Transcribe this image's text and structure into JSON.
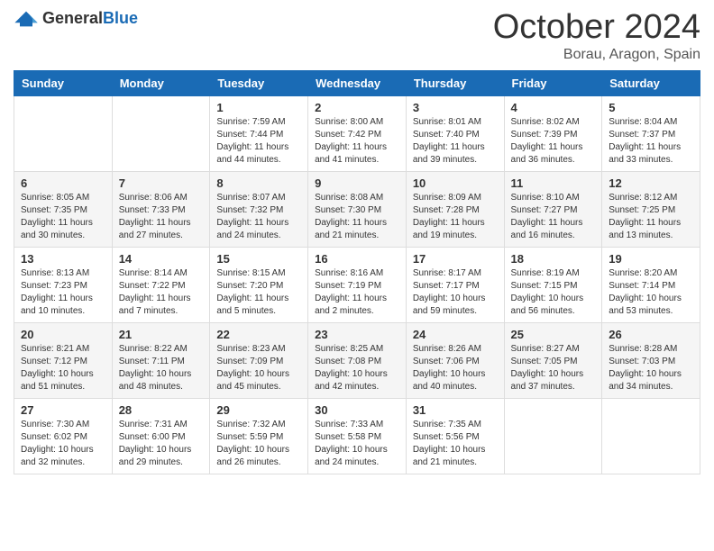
{
  "header": {
    "logo_general": "General",
    "logo_blue": "Blue",
    "month_title": "October 2024",
    "location": "Borau, Aragon, Spain"
  },
  "calendar": {
    "days_of_week": [
      "Sunday",
      "Monday",
      "Tuesday",
      "Wednesday",
      "Thursday",
      "Friday",
      "Saturday"
    ],
    "weeks": [
      [
        {
          "day": "",
          "info": ""
        },
        {
          "day": "",
          "info": ""
        },
        {
          "day": "1",
          "info": "Sunrise: 7:59 AM\nSunset: 7:44 PM\nDaylight: 11 hours and 44 minutes."
        },
        {
          "day": "2",
          "info": "Sunrise: 8:00 AM\nSunset: 7:42 PM\nDaylight: 11 hours and 41 minutes."
        },
        {
          "day": "3",
          "info": "Sunrise: 8:01 AM\nSunset: 7:40 PM\nDaylight: 11 hours and 39 minutes."
        },
        {
          "day": "4",
          "info": "Sunrise: 8:02 AM\nSunset: 7:39 PM\nDaylight: 11 hours and 36 minutes."
        },
        {
          "day": "5",
          "info": "Sunrise: 8:04 AM\nSunset: 7:37 PM\nDaylight: 11 hours and 33 minutes."
        }
      ],
      [
        {
          "day": "6",
          "info": "Sunrise: 8:05 AM\nSunset: 7:35 PM\nDaylight: 11 hours and 30 minutes."
        },
        {
          "day": "7",
          "info": "Sunrise: 8:06 AM\nSunset: 7:33 PM\nDaylight: 11 hours and 27 minutes."
        },
        {
          "day": "8",
          "info": "Sunrise: 8:07 AM\nSunset: 7:32 PM\nDaylight: 11 hours and 24 minutes."
        },
        {
          "day": "9",
          "info": "Sunrise: 8:08 AM\nSunset: 7:30 PM\nDaylight: 11 hours and 21 minutes."
        },
        {
          "day": "10",
          "info": "Sunrise: 8:09 AM\nSunset: 7:28 PM\nDaylight: 11 hours and 19 minutes."
        },
        {
          "day": "11",
          "info": "Sunrise: 8:10 AM\nSunset: 7:27 PM\nDaylight: 11 hours and 16 minutes."
        },
        {
          "day": "12",
          "info": "Sunrise: 8:12 AM\nSunset: 7:25 PM\nDaylight: 11 hours and 13 minutes."
        }
      ],
      [
        {
          "day": "13",
          "info": "Sunrise: 8:13 AM\nSunset: 7:23 PM\nDaylight: 11 hours and 10 minutes."
        },
        {
          "day": "14",
          "info": "Sunrise: 8:14 AM\nSunset: 7:22 PM\nDaylight: 11 hours and 7 minutes."
        },
        {
          "day": "15",
          "info": "Sunrise: 8:15 AM\nSunset: 7:20 PM\nDaylight: 11 hours and 5 minutes."
        },
        {
          "day": "16",
          "info": "Sunrise: 8:16 AM\nSunset: 7:19 PM\nDaylight: 11 hours and 2 minutes."
        },
        {
          "day": "17",
          "info": "Sunrise: 8:17 AM\nSunset: 7:17 PM\nDaylight: 10 hours and 59 minutes."
        },
        {
          "day": "18",
          "info": "Sunrise: 8:19 AM\nSunset: 7:15 PM\nDaylight: 10 hours and 56 minutes."
        },
        {
          "day": "19",
          "info": "Sunrise: 8:20 AM\nSunset: 7:14 PM\nDaylight: 10 hours and 53 minutes."
        }
      ],
      [
        {
          "day": "20",
          "info": "Sunrise: 8:21 AM\nSunset: 7:12 PM\nDaylight: 10 hours and 51 minutes."
        },
        {
          "day": "21",
          "info": "Sunrise: 8:22 AM\nSunset: 7:11 PM\nDaylight: 10 hours and 48 minutes."
        },
        {
          "day": "22",
          "info": "Sunrise: 8:23 AM\nSunset: 7:09 PM\nDaylight: 10 hours and 45 minutes."
        },
        {
          "day": "23",
          "info": "Sunrise: 8:25 AM\nSunset: 7:08 PM\nDaylight: 10 hours and 42 minutes."
        },
        {
          "day": "24",
          "info": "Sunrise: 8:26 AM\nSunset: 7:06 PM\nDaylight: 10 hours and 40 minutes."
        },
        {
          "day": "25",
          "info": "Sunrise: 8:27 AM\nSunset: 7:05 PM\nDaylight: 10 hours and 37 minutes."
        },
        {
          "day": "26",
          "info": "Sunrise: 8:28 AM\nSunset: 7:03 PM\nDaylight: 10 hours and 34 minutes."
        }
      ],
      [
        {
          "day": "27",
          "info": "Sunrise: 7:30 AM\nSunset: 6:02 PM\nDaylight: 10 hours and 32 minutes."
        },
        {
          "day": "28",
          "info": "Sunrise: 7:31 AM\nSunset: 6:00 PM\nDaylight: 10 hours and 29 minutes."
        },
        {
          "day": "29",
          "info": "Sunrise: 7:32 AM\nSunset: 5:59 PM\nDaylight: 10 hours and 26 minutes."
        },
        {
          "day": "30",
          "info": "Sunrise: 7:33 AM\nSunset: 5:58 PM\nDaylight: 10 hours and 24 minutes."
        },
        {
          "day": "31",
          "info": "Sunrise: 7:35 AM\nSunset: 5:56 PM\nDaylight: 10 hours and 21 minutes."
        },
        {
          "day": "",
          "info": ""
        },
        {
          "day": "",
          "info": ""
        }
      ]
    ]
  }
}
